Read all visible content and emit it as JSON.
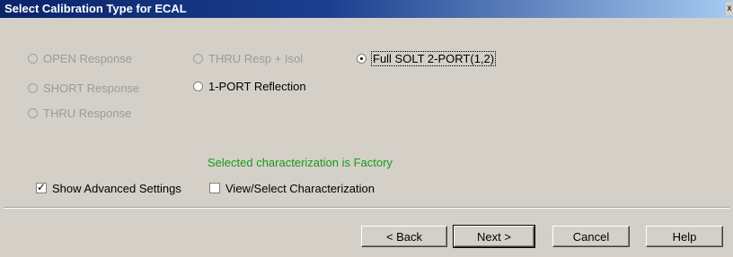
{
  "window": {
    "title": "Select Calibration Type for ECAL",
    "title_button": "x"
  },
  "radios": [
    {
      "label": "OPEN Response",
      "enabled": false,
      "checked": false
    },
    {
      "label": "SHORT Response",
      "enabled": false,
      "checked": false
    },
    {
      "label": "THRU Response",
      "enabled": false,
      "checked": false
    },
    {
      "label": "THRU Resp + Isol",
      "enabled": false,
      "checked": false
    },
    {
      "label": "1-PORT Reflection",
      "enabled": true,
      "checked": false
    },
    {
      "label": "Full SOLT 2-PORT(1,2)",
      "enabled": true,
      "checked": true
    }
  ],
  "status": {
    "text": "Selected characterization is Factory",
    "color": "#1a9a1a"
  },
  "checkboxes": {
    "show_advanced": {
      "label": "Show Advanced Settings",
      "checked": true
    },
    "view_select": {
      "label": "View/Select Characterization",
      "checked": false
    }
  },
  "buttons": {
    "back": "< Back",
    "next": "Next >",
    "cancel": "Cancel",
    "help": "Help"
  }
}
